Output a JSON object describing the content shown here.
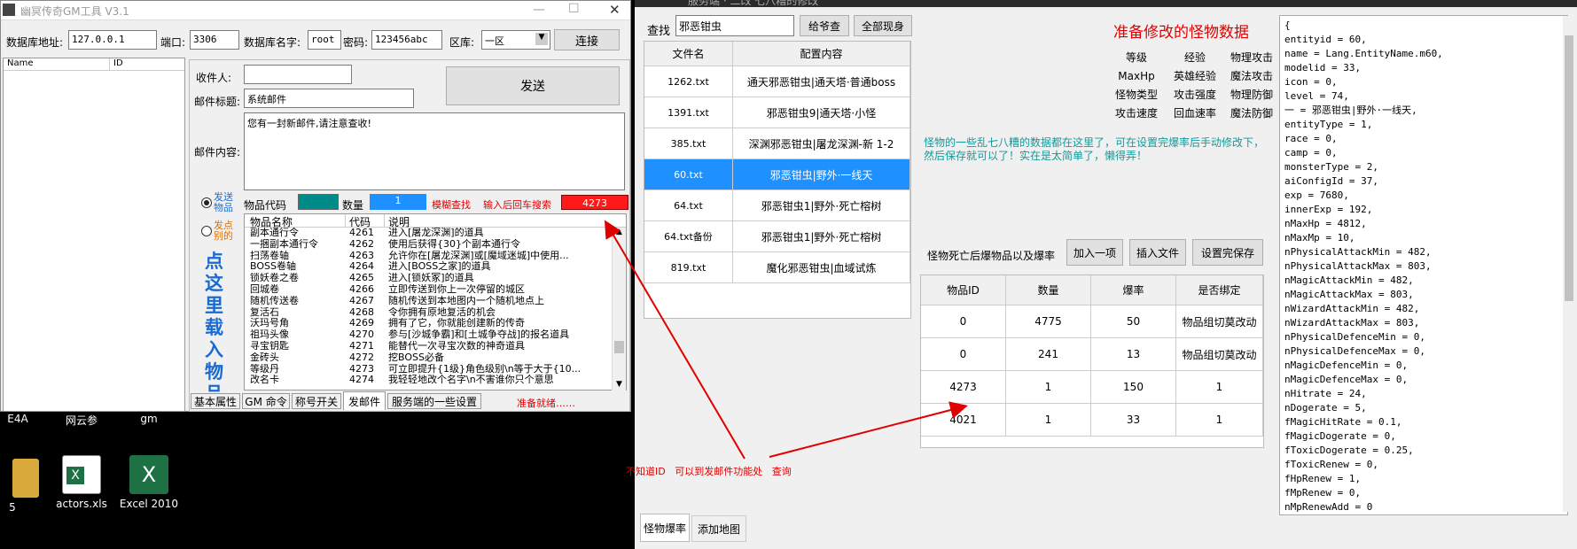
{
  "gm_window": {
    "title": "幽冥传奇GM工具 V3.1",
    "db_addr_label": "数据库地址:",
    "db_addr": "127.0.0.1",
    "port_label": "端口:",
    "port": "3306",
    "dbname_label": "数据库名字:",
    "dbname": "root",
    "pwd_label": "密码:",
    "pwd": "123456abc",
    "zone_label": "区库:",
    "zone": "一区",
    "connect": "连接",
    "col_name": "Name",
    "col_id": "ID",
    "recipient_label": "收件人:",
    "subject_label": "邮件标题:",
    "subject": "系统邮件",
    "content_label": "邮件内容:",
    "content": "您有一封新邮件,请注意查收!",
    "send": "发送",
    "radio_send_item": "发送物品",
    "radio_send_yuanbao": "发点别的",
    "side_text": "点这里载入物品",
    "item_code_label": "物品代码",
    "qty_label": "数量",
    "qty": "1",
    "fuzzy": "模糊查找",
    "search_hint": "输入后回车搜索",
    "search_val": "4273",
    "list_headers": [
      "物品名称",
      "代码",
      "说明"
    ],
    "items": [
      {
        "name": "副本通行令",
        "code": "4261",
        "desc": "进入[屠龙深渊]的道具"
      },
      {
        "name": "一捆副本通行令",
        "code": "4262",
        "desc": "使用后获得{30}个副本通行令"
      },
      {
        "name": "扫荡卷轴",
        "code": "4263",
        "desc": "允许你在[屠龙深渊]或[魔域迷城]中使用..."
      },
      {
        "name": "BOSS卷轴",
        "code": "4264",
        "desc": "进入[BOSS之家]的道具"
      },
      {
        "name": "锁妖卷之卷",
        "code": "4265",
        "desc": "进入[锁妖冢]的道具"
      },
      {
        "name": "回城卷",
        "code": "4266",
        "desc": "立即传送到你上一次停留的城区"
      },
      {
        "name": "随机传送卷",
        "code": "4267",
        "desc": "随机传送到本地图内一个随机地点上"
      },
      {
        "name": "复活石",
        "code": "4268",
        "desc": "令你拥有原地复活的机会"
      },
      {
        "name": "沃玛号角",
        "code": "4269",
        "desc": "拥有了它，你就能创建新的传奇"
      },
      {
        "name": "祖玛头像",
        "code": "4270",
        "desc": "参与[沙城争霸]和[土城争夺战]的报名道具"
      },
      {
        "name": "寻宝钥匙",
        "code": "4271",
        "desc": "能替代一次寻宝次数的神奇道具"
      },
      {
        "name": "金砖头",
        "code": "4272",
        "desc": "挖BOSS必备"
      },
      {
        "name": "等级丹",
        "code": "4273",
        "desc": "可立即提升{1级}角色级别\\n等于大于{10..."
      },
      {
        "name": "改名卡",
        "code": "4274",
        "desc": "我轻轻地改个名字\\n不害谁你只个意思"
      }
    ],
    "tabs": [
      "基本属性",
      "GM 命令",
      "称号开关",
      "发邮件",
      "服务端的一些设置"
    ],
    "status": "准备就绪……"
  },
  "desktop": {
    "labels": [
      "E4A",
      "网云参",
      "gm",
      "5",
      "actors.xls",
      "Excel 2010"
    ]
  },
  "srv_window": {
    "title": "服务端 · 二改 七八糟的修改",
    "search_label": "查找",
    "search_value": "邪恶钳虫",
    "give_btn": "给爷查",
    "show_all_btn": "全部现身",
    "file_headers": [
      "文件名",
      "配置内容"
    ],
    "files": [
      {
        "file": "1262.txt",
        "cfg": "通天邪恶钳虫|通天塔·普通boss"
      },
      {
        "file": "1391.txt",
        "cfg": "邪恶钳虫9|通天塔·小怪"
      },
      {
        "file": "385.txt",
        "cfg": "深渊邪恶钳虫|屠龙深渊-新 1-2"
      },
      {
        "file": "60.txt",
        "cfg": "邪恶钳虫|野外·一线天"
      },
      {
        "file": "64.txt",
        "cfg": "邪恶钳虫1|野外·死亡榕树"
      },
      {
        "file": "64.txt备份",
        "cfg": "邪恶钳虫1|野外·死亡榕树"
      },
      {
        "file": "819.txt",
        "cfg": "魔化邪恶钳虫|血域试炼"
      }
    ],
    "heading": "准备修改的怪物数据",
    "attrs": [
      [
        "等级",
        "经验",
        "物理攻击"
      ],
      [
        "MaxHp",
        "英雄经验",
        "魔法攻击"
      ],
      [
        "怪物类型",
        "攻击强度",
        "物理防御"
      ],
      [
        "攻击速度",
        "回血速率",
        "魔法防御"
      ]
    ],
    "note": "怪物的一些乱七八糟的数据都在这里了，可在设置完爆率后手动修改下，然后保存就可以了！实在是太简单了，懒得弄！",
    "drop_label": "怪物死亡后爆物品以及爆率",
    "add_btn": "加入一项",
    "insert_btn": "插入文件",
    "save_btn": "设置完保存",
    "drop_headers": [
      "物品ID",
      "数量",
      "爆率",
      "是否绑定"
    ],
    "drops": [
      {
        "id": "0",
        "qty": "4775",
        "rate": "50",
        "bind": "物品组切莫改动"
      },
      {
        "id": "0",
        "qty": "241",
        "rate": "13",
        "bind": "物品组切莫改动"
      },
      {
        "id": "4273",
        "qty": "1",
        "rate": "150",
        "bind": "1"
      },
      {
        "id": "4021",
        "qty": "1",
        "rate": "33",
        "bind": "1"
      }
    ],
    "annotation": "不知道ID   可以到发邮件功能处   查询",
    "bottom_tabs": [
      "怪物爆率",
      "添加地图"
    ],
    "code_lines": [
      "{",
      "entityid = 60,",
      "name = Lang.EntityName.m60,",
      "modelid = 33,",
      "icon = 0,",
      "level = 74,",
      "一 = 邪恶钳虫|野外·一线天,",
      "entityType = 1,",
      "race = 0,",
      "camp = 0,",
      "monsterType = 2,",
      "aiConfigId = 37,",
      "exp = 7680,",
      "innerExp = 192,",
      "nMaxHp = 4812,",
      "nMaxMp = 10,",
      "nPhysicalAttackMin = 482,",
      "nPhysicalAttackMax = 803,",
      "nMagicAttackMin = 482,",
      "nMagicAttackMax = 803,",
      "nWizardAttackMin = 482,",
      "nWizardAttackMax = 803,",
      "nPhysicalDefenceMin = 0,",
      "nPhysicalDefenceMax = 0,",
      "nMagicDefenceMin = 0,",
      "nMagicDefenceMax = 0,",
      "nHitrate = 24,",
      "nDogerate = 5,",
      "fMagicHitRate = 0.1,",
      "fMagicDogerate = 0,",
      "fToxicDogerate = 0.25,",
      "fToxicRenew = 0,",
      "fHpRenew = 1,",
      "fMpRenew = 0,",
      "nMpRenewAdd = 0"
    ]
  }
}
